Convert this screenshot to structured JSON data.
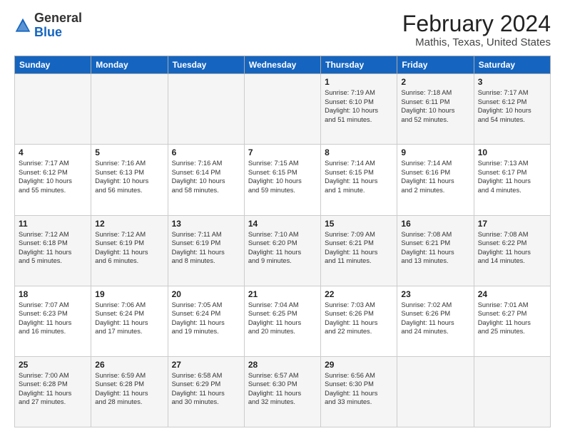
{
  "logo": {
    "general": "General",
    "blue": "Blue"
  },
  "title": "February 2024",
  "subtitle": "Mathis, Texas, United States",
  "columns": [
    "Sunday",
    "Monday",
    "Tuesday",
    "Wednesday",
    "Thursday",
    "Friday",
    "Saturday"
  ],
  "weeks": [
    [
      {
        "day": "",
        "text": ""
      },
      {
        "day": "",
        "text": ""
      },
      {
        "day": "",
        "text": ""
      },
      {
        "day": "",
        "text": ""
      },
      {
        "day": "1",
        "text": "Sunrise: 7:19 AM\nSunset: 6:10 PM\nDaylight: 10 hours\nand 51 minutes."
      },
      {
        "day": "2",
        "text": "Sunrise: 7:18 AM\nSunset: 6:11 PM\nDaylight: 10 hours\nand 52 minutes."
      },
      {
        "day": "3",
        "text": "Sunrise: 7:17 AM\nSunset: 6:12 PM\nDaylight: 10 hours\nand 54 minutes."
      }
    ],
    [
      {
        "day": "4",
        "text": "Sunrise: 7:17 AM\nSunset: 6:12 PM\nDaylight: 10 hours\nand 55 minutes."
      },
      {
        "day": "5",
        "text": "Sunrise: 7:16 AM\nSunset: 6:13 PM\nDaylight: 10 hours\nand 56 minutes."
      },
      {
        "day": "6",
        "text": "Sunrise: 7:16 AM\nSunset: 6:14 PM\nDaylight: 10 hours\nand 58 minutes."
      },
      {
        "day": "7",
        "text": "Sunrise: 7:15 AM\nSunset: 6:15 PM\nDaylight: 10 hours\nand 59 minutes."
      },
      {
        "day": "8",
        "text": "Sunrise: 7:14 AM\nSunset: 6:15 PM\nDaylight: 11 hours\nand 1 minute."
      },
      {
        "day": "9",
        "text": "Sunrise: 7:14 AM\nSunset: 6:16 PM\nDaylight: 11 hours\nand 2 minutes."
      },
      {
        "day": "10",
        "text": "Sunrise: 7:13 AM\nSunset: 6:17 PM\nDaylight: 11 hours\nand 4 minutes."
      }
    ],
    [
      {
        "day": "11",
        "text": "Sunrise: 7:12 AM\nSunset: 6:18 PM\nDaylight: 11 hours\nand 5 minutes."
      },
      {
        "day": "12",
        "text": "Sunrise: 7:12 AM\nSunset: 6:19 PM\nDaylight: 11 hours\nand 6 minutes."
      },
      {
        "day": "13",
        "text": "Sunrise: 7:11 AM\nSunset: 6:19 PM\nDaylight: 11 hours\nand 8 minutes."
      },
      {
        "day": "14",
        "text": "Sunrise: 7:10 AM\nSunset: 6:20 PM\nDaylight: 11 hours\nand 9 minutes."
      },
      {
        "day": "15",
        "text": "Sunrise: 7:09 AM\nSunset: 6:21 PM\nDaylight: 11 hours\nand 11 minutes."
      },
      {
        "day": "16",
        "text": "Sunrise: 7:08 AM\nSunset: 6:21 PM\nDaylight: 11 hours\nand 13 minutes."
      },
      {
        "day": "17",
        "text": "Sunrise: 7:08 AM\nSunset: 6:22 PM\nDaylight: 11 hours\nand 14 minutes."
      }
    ],
    [
      {
        "day": "18",
        "text": "Sunrise: 7:07 AM\nSunset: 6:23 PM\nDaylight: 11 hours\nand 16 minutes."
      },
      {
        "day": "19",
        "text": "Sunrise: 7:06 AM\nSunset: 6:24 PM\nDaylight: 11 hours\nand 17 minutes."
      },
      {
        "day": "20",
        "text": "Sunrise: 7:05 AM\nSunset: 6:24 PM\nDaylight: 11 hours\nand 19 minutes."
      },
      {
        "day": "21",
        "text": "Sunrise: 7:04 AM\nSunset: 6:25 PM\nDaylight: 11 hours\nand 20 minutes."
      },
      {
        "day": "22",
        "text": "Sunrise: 7:03 AM\nSunset: 6:26 PM\nDaylight: 11 hours\nand 22 minutes."
      },
      {
        "day": "23",
        "text": "Sunrise: 7:02 AM\nSunset: 6:26 PM\nDaylight: 11 hours\nand 24 minutes."
      },
      {
        "day": "24",
        "text": "Sunrise: 7:01 AM\nSunset: 6:27 PM\nDaylight: 11 hours\nand 25 minutes."
      }
    ],
    [
      {
        "day": "25",
        "text": "Sunrise: 7:00 AM\nSunset: 6:28 PM\nDaylight: 11 hours\nand 27 minutes."
      },
      {
        "day": "26",
        "text": "Sunrise: 6:59 AM\nSunset: 6:28 PM\nDaylight: 11 hours\nand 28 minutes."
      },
      {
        "day": "27",
        "text": "Sunrise: 6:58 AM\nSunset: 6:29 PM\nDaylight: 11 hours\nand 30 minutes."
      },
      {
        "day": "28",
        "text": "Sunrise: 6:57 AM\nSunset: 6:30 PM\nDaylight: 11 hours\nand 32 minutes."
      },
      {
        "day": "29",
        "text": "Sunrise: 6:56 AM\nSunset: 6:30 PM\nDaylight: 11 hours\nand 33 minutes."
      },
      {
        "day": "",
        "text": ""
      },
      {
        "day": "",
        "text": ""
      }
    ]
  ]
}
